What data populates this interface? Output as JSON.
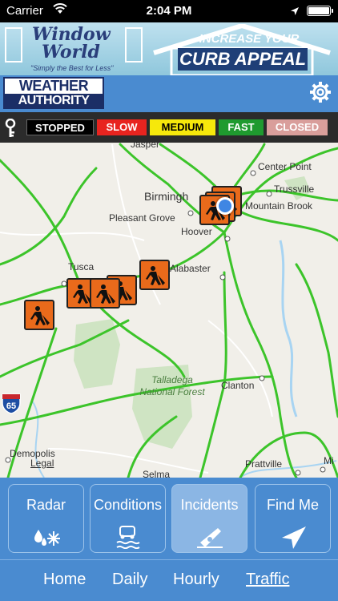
{
  "status_bar": {
    "carrier": "Carrier",
    "time": "2:04 PM"
  },
  "ad": {
    "brand_line1": "Window",
    "brand_line2": "World",
    "slogan": "\"Simply the Best for Less\"",
    "headline1": "INCREASE YOUR",
    "headline2": "CURB APPEAL"
  },
  "header": {
    "logo_line1": "WEATHER",
    "logo_line2": "AUTHORITY",
    "settings_icon": "gear-icon"
  },
  "legend": {
    "items": [
      {
        "label": "STOPPED",
        "color": "#000000",
        "text_color": "#ffffff"
      },
      {
        "label": "SLOW",
        "color": "#e8241f",
        "text_color": "#ffffff"
      },
      {
        "label": "MEDIUM",
        "color": "#f6e80b",
        "text_color": "#000000"
      },
      {
        "label": "FAST",
        "color": "#1f9a2f",
        "text_color": "#ffffff"
      },
      {
        "label": "CLOSED",
        "color": "#d99e9b",
        "text_color": "#ffffff"
      }
    ]
  },
  "map": {
    "labels": {
      "jasper": "Jasper",
      "center_point": "Center Point",
      "trussville": "Trussville",
      "birmingham": "Birmingh",
      "mountain_brook": "Mountain Brook",
      "pleasant_grove": "Pleasant Grove",
      "hoover": "Hoover",
      "alabaster": "Alabaster",
      "tuscaloosa": "Tusca",
      "clanton": "Clanton",
      "forest1": "Talladega",
      "forest2": "National Forest",
      "demopolis": "Demopolis",
      "legal": "Legal",
      "prattville": "Prattville",
      "selma": "Selma",
      "millbrook": "Mi"
    },
    "interstate_shield": "65",
    "interstate_shield_top": "65",
    "incident_icon": "road-work-icon",
    "incident_count": 8
  },
  "tabs": [
    {
      "label": "Radar",
      "icon": "rain-snow-icon",
      "active": false
    },
    {
      "label": "Conditions",
      "icon": "slippery-road-icon",
      "active": false
    },
    {
      "label": "Incidents",
      "icon": "road-incident-icon",
      "active": true
    },
    {
      "label": "Find Me",
      "icon": "location-arrow-icon",
      "active": false
    }
  ],
  "bottom_nav": [
    {
      "label": "Home",
      "active": false
    },
    {
      "label": "Daily",
      "active": false
    },
    {
      "label": "Hourly",
      "active": false
    },
    {
      "label": "Traffic",
      "active": true
    }
  ]
}
